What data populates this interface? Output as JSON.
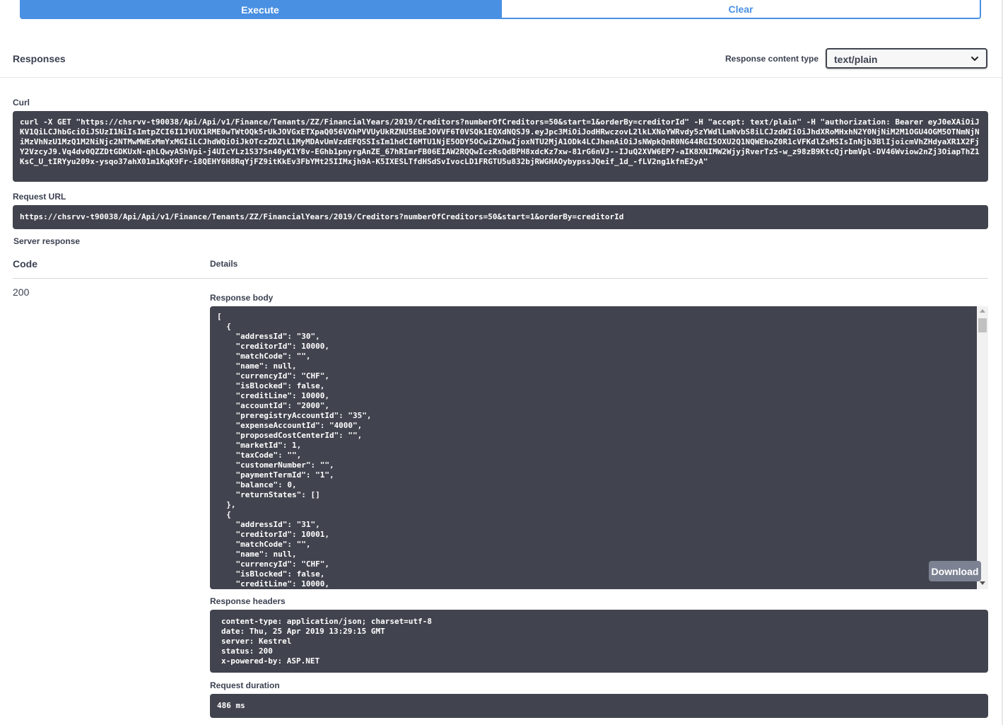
{
  "toolbar": {
    "execute_label": "Execute",
    "clear_label": "Clear"
  },
  "responses": {
    "title": "Responses",
    "content_type_label": "Response content type",
    "content_type_value": "text/plain"
  },
  "curl": {
    "label": "Curl",
    "command": "curl -X GET \"https://chsrvv-t90038/Api/Api/v1/Finance/Tenants/ZZ/FinancialYears/2019/Creditors?numberOfCreditors=50&start=1&orderBy=creditorId\" -H \"accept: text/plain\" -H \"authorization: Bearer eyJ0eXAiOiJKV1QiLCJhbGciOiJSUzI1NiIsImtpZCI6I1JVUX1RME0wTWtOQk5rUkJOVGxETXpaQ056VXhPVVUyUkRZNU5EbEJOVVF6T0VSQk1EQXdNQSJ9.eyJpc3MiOiJodHRwczovL2lkLXNoYWRvdy5zYWdlLmNvbS8iLCJzdWIiOiJhdXRoMHxhN2Y0NjNiM2M1OGU4OGM5OTNmNjNiMzVhNzU1MzQ1M2NiNjc2NTMwMWExMmYxMGIiLCJhdWQiOiJkOTczZDZlL1MyMDAvUmVzdEFQSSIsIm1hdCI6MTU1NjE5ODY5OCwiZXhwIjoxNTU2MjA1ODk4LCJhenAiOiJsNWpkQnR0NG44RGI5OXU2Q1NQWEhoZ0R1cVFKdlZsMSIsInNjb3BlIjoicmVhZHdyaXR1X2FjY2VzcyJ9.Vq4dv0QZZDtGDKUxN-qhLQwyAShVpi-j4UIcYLz1S37Sn40yK1Y8v-EGhb1pnyrgAnZE_67hRImrFB06EIAW2RQQwIczRsQdBPH8xdcKz7xw-81rG6nVJ--IJuQ2XVW6EP7-aIK8XNIMW2WjyjRverTzS-w_z98zB9KtcQjrbmVpl-DV46Wviow2nZj3OiapThZ1KsC_U_tIRYyu209x-ysqo37ahX01m1KqK9Fr-i8QEHY6H8RqYjFZ9itKkEv3FbYMt25IIMxjh9A-K5IXESLTfdHSdSvIvocLD1FRGTU5u832bjRWGHAOybypssJQeif_1d_-fLV2ng1kfnE2yA\""
  },
  "request_url": {
    "label": "Request URL",
    "value": "https://chsrvv-t90038/Api/Api/v1/Finance/Tenants/ZZ/FinancialYears/2019/Creditors?numberOfCreditors=50&start=1&orderBy=creditorId"
  },
  "server_response": {
    "label": "Server response",
    "code_header": "Code",
    "details_header": "Details",
    "status_code": "200",
    "body_label": "Response body",
    "body": "[\n  {\n    \"addressId\": \"30\",\n    \"creditorId\": 10000,\n    \"matchCode\": \"\",\n    \"name\": null,\n    \"currencyId\": \"CHF\",\n    \"isBlocked\": false,\n    \"creditLine\": 10000,\n    \"accountId\": \"2000\",\n    \"preregistryAccountId\": \"35\",\n    \"expenseAccountId\": \"4000\",\n    \"proposedCostCenterId\": \"\",\n    \"marketId\": 1,\n    \"taxCode\": \"\",\n    \"customerNumber\": \"\",\n    \"paymentTermId\": \"1\",\n    \"balance\": 0,\n    \"returnStates\": []\n  },\n  {\n    \"addressId\": \"31\",\n    \"creditorId\": 10001,\n    \"matchCode\": \"\",\n    \"name\": null,\n    \"currencyId\": \"CHF\",\n    \"isBlocked\": false,\n    \"creditLine\": 10000,",
    "download_label": "Download",
    "headers_label": "Response headers",
    "headers": "content-type: application/json; charset=utf-8\ndate: Thu, 25 Apr 2019 13:29:15 GMT\nserver: Kestrel\nstatus: 200\nx-powered-by: ASP.NET",
    "duration_label": "Request duration",
    "duration": "486 ms"
  }
}
